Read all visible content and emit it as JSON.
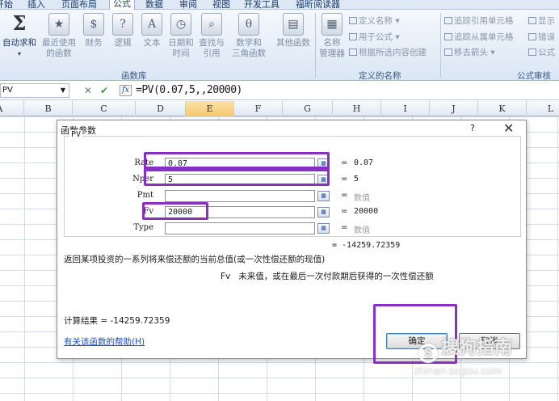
{
  "ribbon_tabs": [
    "开始",
    "插入",
    "页面布局",
    "公式",
    "数据",
    "审阅",
    "视图",
    "开发工具",
    "福昕阅读器"
  ],
  "active_tab": "公式",
  "function_library": {
    "autosum": "自动求和",
    "recent": [
      "最近使用",
      "的函数"
    ],
    "financial": "财务",
    "logical": "逻辑",
    "text": "文本",
    "datetime": [
      "日期和",
      "时间"
    ],
    "lookup": [
      "查找与",
      "引用"
    ],
    "math": [
      "数学和",
      "三角函数"
    ],
    "more": "其他函数",
    "group_label": "函数库"
  },
  "defined_names": {
    "name_manager": [
      "名称",
      "管理器"
    ],
    "define_name": "定义名称",
    "use_in_formula": "用于公式",
    "create_from_selection": "根据所选内容创建",
    "group_label": "定义的名称"
  },
  "formula_auditing": {
    "trace_precedents": "追踪引用单元格",
    "trace_dependents": "追踪从属单元格",
    "remove_arrows": "移去箭头",
    "show": "显示",
    "error_check": "错误",
    "evaluate": "公式",
    "group_label": "公式审核"
  },
  "formula_bar": {
    "name_box": "PV",
    "cancel": "✕",
    "enter": "✔",
    "fx": "fx",
    "formula": "=PV(0.07,5,,20000)"
  },
  "columns": [
    "A",
    "B",
    "C",
    "D",
    "E",
    "F",
    "G",
    "H",
    "I",
    "J",
    "K",
    "L"
  ],
  "selected_column": "E",
  "dialog": {
    "title": "函数参数",
    "help_q": "?",
    "close": "✕",
    "function_name": "PV",
    "args": [
      {
        "label": "Rate",
        "value": "0.07",
        "result": "0.07"
      },
      {
        "label": "Nper",
        "value": "5",
        "result": "5"
      },
      {
        "label": "Pmt",
        "value": "",
        "result": "数值"
      },
      {
        "label": "Fv",
        "value": "20000",
        "result": "20000"
      },
      {
        "label": "Type",
        "value": "",
        "result": "数值"
      }
    ],
    "result_eq": "= -14259.72359",
    "description": "返回某项投资的一系列将来偿还额的当前总值(或一次性偿还额的现值)",
    "param_name": "Fv",
    "param_desc": "未来值，或在最后一次付款期后获得的一次性偿还额",
    "calc_result": "计算结果 = -14259.72359",
    "help_link": "有关该函数的帮助(H)",
    "ok": "确定",
    "cancel": "取消"
  },
  "watermark": {
    "text": "搜狗指南",
    "url": "zhinan.sogou.com"
  },
  "colors": {
    "highlight": "#8a2fc4",
    "accent": "#1f3a63"
  }
}
